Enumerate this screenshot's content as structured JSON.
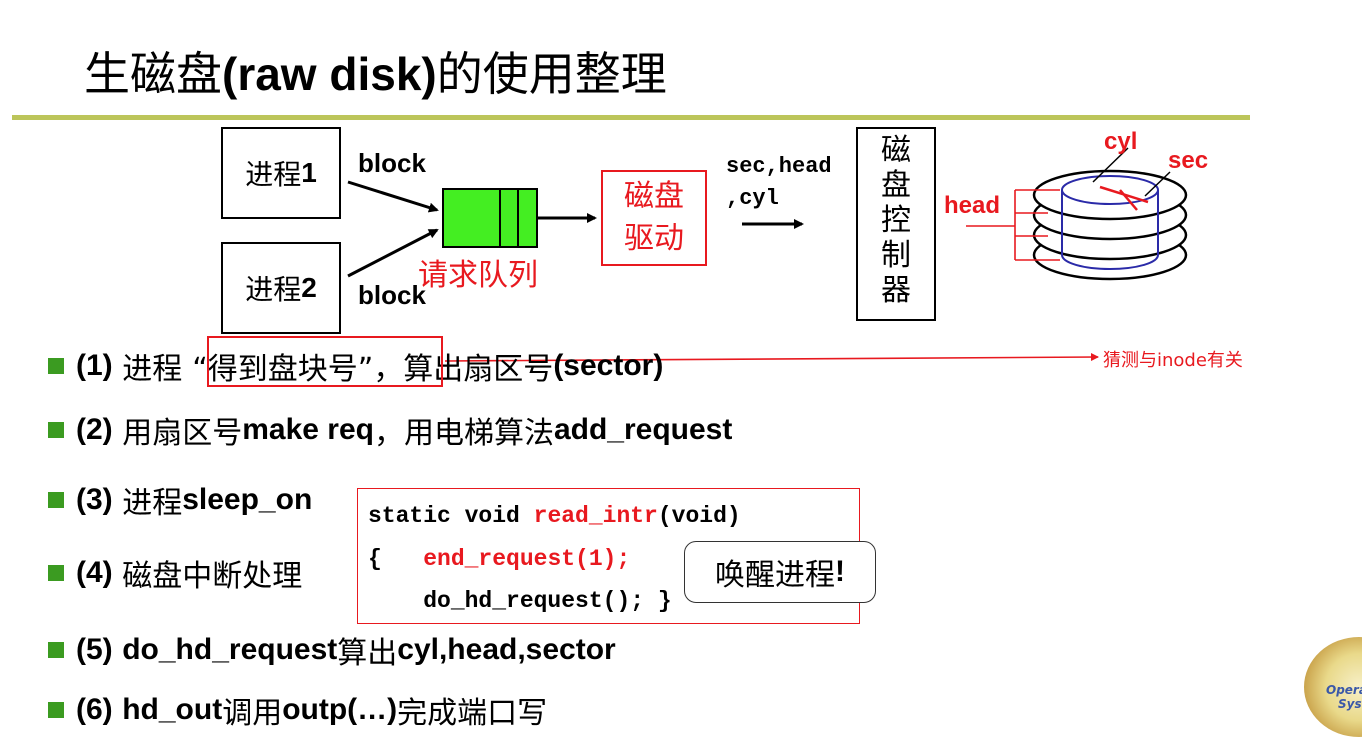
{
  "title": {
    "prefix": "生磁盘",
    "bold": "(raw disk)",
    "suffix": "的使用整理"
  },
  "diagram": {
    "process1": {
      "label": "进程",
      "num": "1"
    },
    "process2": {
      "label": "进程",
      "num": "2"
    },
    "block_top": "block",
    "block_bottom": "block",
    "queue_label": "请求队列",
    "driver_line1": "磁盘",
    "driver_line2": "驱动",
    "params_line1": "sec,head",
    "params_line2": ",cyl",
    "controller_chars": [
      "磁",
      "盘",
      "控",
      "制",
      "器"
    ],
    "disk_cyl": "cyl",
    "disk_sec": "sec",
    "disk_head": "head"
  },
  "bullets": {
    "b1": {
      "num": "(1)",
      "text1": "进程",
      "highlight": "“得到盘块号”",
      "text2": "，算出扇区号",
      "bold2": "(sector)"
    },
    "b2": {
      "num": "(2)",
      "text1": "用扇区号",
      "bold1": "make req",
      "text2": "，用电梯算法",
      "bold2": "add_request"
    },
    "b3": {
      "num": "(3)",
      "text1": "进程",
      "bold1": "sleep_on"
    },
    "b4": {
      "num": "(4)",
      "text1": "磁盘中断处理"
    },
    "b5": {
      "num": "(5)",
      "bold1": "do_hd_request",
      "text1": "算出",
      "bold2": "cyl,head,sector"
    },
    "b6": {
      "num": "(6)",
      "bold1": "hd_out",
      "text1": "调用",
      "bold2": "outp(…)",
      "text2": "完成端口写"
    }
  },
  "code": {
    "line1_a": "static void ",
    "line1_fn": "read_intr",
    "line1_b": "(void)",
    "line2_a": "{   ",
    "line2_call": "end_request(1);",
    "line3": "    do_hd_request(); }"
  },
  "bubble": {
    "text": "唤醒进程",
    "bang": "!"
  },
  "annotation": "猜测与inode有关",
  "colors": {
    "accent_red": "#e8191f",
    "queue_green": "#44ee22",
    "title_rule": "#bcc55a",
    "bullet_green": "#3b9b21",
    "disk_blue": "#2a2aa8"
  }
}
